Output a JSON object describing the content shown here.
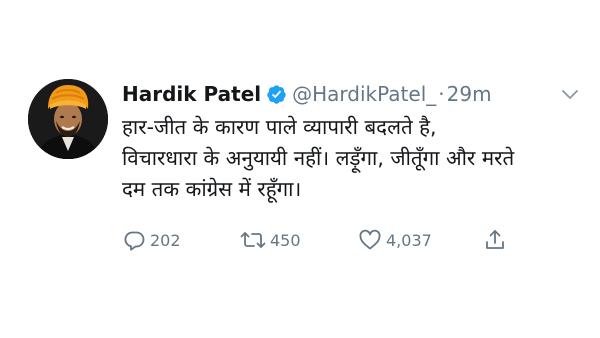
{
  "user": {
    "display_name": "Hardik Patel",
    "handle": "@HardikPatel_",
    "separator": "·",
    "time": "29m"
  },
  "tweet": {
    "lines": [
      "हार-जीत के कारण पाले व्यापारी बदलते है,",
      "विचारधारा के अनुयायी नहीं। लड़ूँगा, जीतूँगा और मरते",
      "दम तक कांग्रेस में रहूँगा।"
    ]
  },
  "actions": {
    "replies": "202",
    "retweets": "450",
    "likes": "4,037"
  },
  "icons": {
    "verified": "verified-badge-icon",
    "caret": "chevron-down-icon",
    "reply": "reply-icon",
    "retweet": "retweet-icon",
    "like": "heart-icon",
    "share": "share-icon"
  },
  "colors": {
    "verified_blue": "#1da1f2",
    "muted_gray": "#657786",
    "text": "#14171a"
  }
}
